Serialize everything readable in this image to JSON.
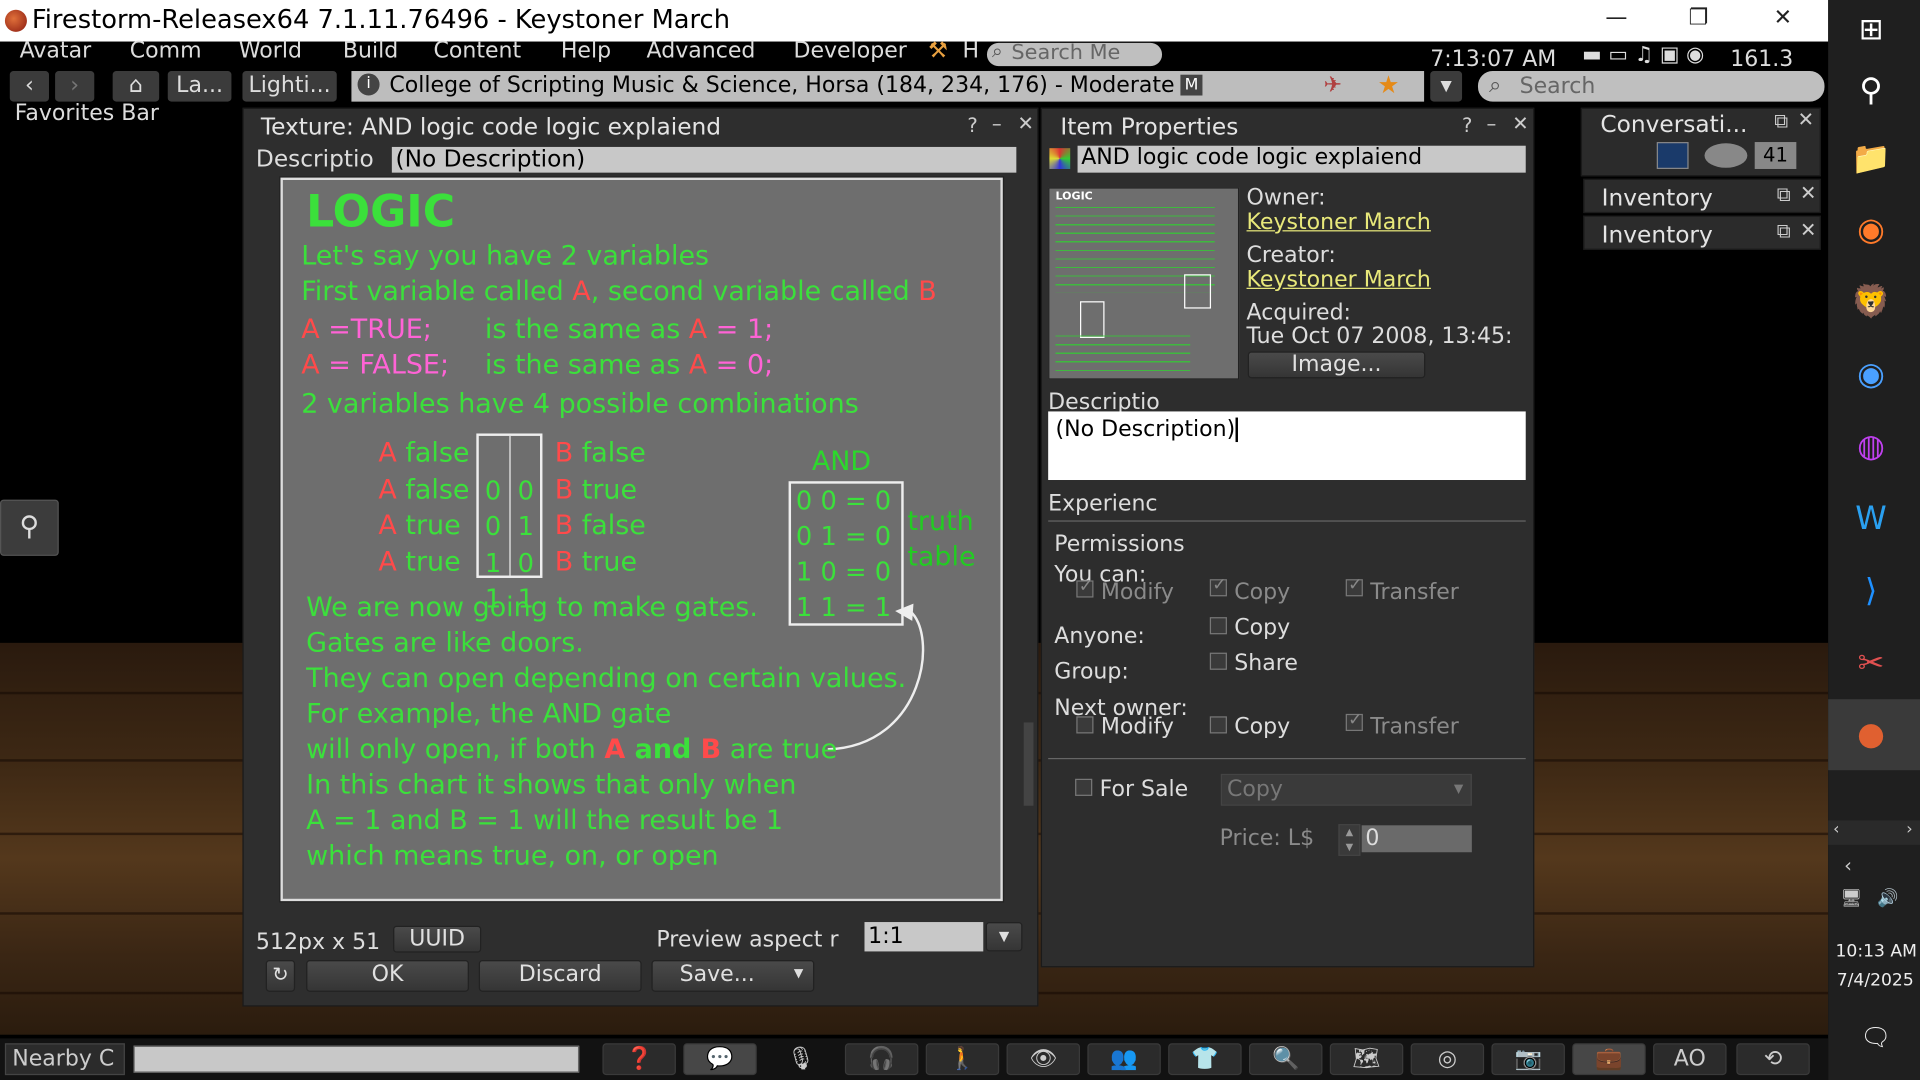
{
  "window": {
    "title": "Firestorm-Releasex64 7.1.11.76496 - Keystoner March"
  },
  "menu": {
    "items": [
      "Avatar",
      "Comm",
      "World",
      "Build",
      "Content",
      "Help",
      "Advanced",
      "Developer"
    ],
    "h_label": "H",
    "search_placeholder": "Search Me",
    "clock": "7:13:07 AM",
    "fps": "161.3"
  },
  "nav": {
    "landmark_btn": "La...",
    "lighting_btn": "Lighti...",
    "location": "College of Scripting Music & Science, Horsa (184, 234, 176) - Moderate",
    "maturity_badge": "M",
    "search_placeholder": "Search"
  },
  "favorites_bar": "Favorites Bar",
  "texture_preview": {
    "title": "Texture: AND logic code logic explaiend",
    "desc_label": "Descriptio",
    "desc_value": "(No Description)",
    "size_text": "512px x 51",
    "uuid_btn": "UUID",
    "aspect_label": "Preview aspect r",
    "aspect_value": "1:1",
    "ok_btn": "OK",
    "discard_btn": "Discard",
    "save_btn": "Save..."
  },
  "texture_image": {
    "heading": "LOGIC",
    "l1": "Let's say you have 2 variables",
    "l2a": "First variable called ",
    "l2b": "A",
    "l2c": ", second variable called ",
    "l2d": "B",
    "l3a": "A",
    "l3b": " =TRUE;",
    "l3c": "is the same as ",
    "l3d": "A",
    "l3e": " = 1;",
    "l4a": "A",
    "l4b": " = FALSE;",
    "l4c": "is the same as ",
    "l4d": "A",
    "l4e": " = 0;",
    "l5": "2 variables have 4 possible combinations",
    "rows": [
      {
        "a": "A",
        "av": "false",
        "bits": "0  0",
        "b": "B",
        "bv": "false"
      },
      {
        "a": "A",
        "av": "false",
        "bits": "0  1",
        "b": "B",
        "bv": "true"
      },
      {
        "a": "A",
        "av": "true",
        "bits": "1  0",
        "b": "B",
        "bv": "false"
      },
      {
        "a": "A",
        "av": "true",
        "bits": "1  1",
        "b": "B",
        "bv": "true"
      }
    ],
    "and_label": "AND",
    "truth": [
      "0 0 = 0",
      "0 1 = 0",
      "1 0 = 0",
      "1 1 = 1"
    ],
    "truth_label1": "truth",
    "truth_label2": "table",
    "p1": "We are now going to make gates.",
    "p2": "Gates are like doors.",
    "p3": "They can open depending on certain values.",
    "p4": "For example, the AND gate",
    "p5a": "will only open, if both ",
    "p5b": "A",
    "p5c": " and ",
    "p5d": "B",
    "p5e": " are true",
    "p6": "In this chart it shows that only when",
    "p7": "A = 1 and B = 1 will the result be 1",
    "p8": "which means true, on, or open"
  },
  "item_properties": {
    "title": "Item Properties",
    "name": "AND logic code logic explaiend",
    "owner_label": "Owner:",
    "owner": "Keystoner March",
    "creator_label": "Creator:",
    "creator": "Keystoner March",
    "acquired_label": "Acquired:",
    "acquired": "Tue Oct 07 2008, 13:45:",
    "image_btn": "Image...",
    "desc_label": "Descriptio",
    "desc_value": "(No Description)",
    "experience_label": "Experienc",
    "permissions_label": "Permissions",
    "you_can_label": "You can:",
    "modify": "Modify",
    "copy": "Copy",
    "transfer": "Transfer",
    "anyone_label": "Anyone:",
    "group_label": "Group:",
    "share": "Share",
    "next_owner_label": "Next owner:",
    "for_sale": "For Sale",
    "sale_type": "Copy",
    "price_label": "Price: L$",
    "price_value": "0",
    "thumb_heading": "LOGIC"
  },
  "side_panels": {
    "conversations": "Conversati...",
    "conv_count": "41",
    "inventory1": "Inventory",
    "inventory2": "Inventory"
  },
  "bottom": {
    "nearby_chat": "Nearby C",
    "ao_label": "AO"
  },
  "taskbar": {
    "time": "10:13 AM",
    "date": "7/4/2025"
  }
}
